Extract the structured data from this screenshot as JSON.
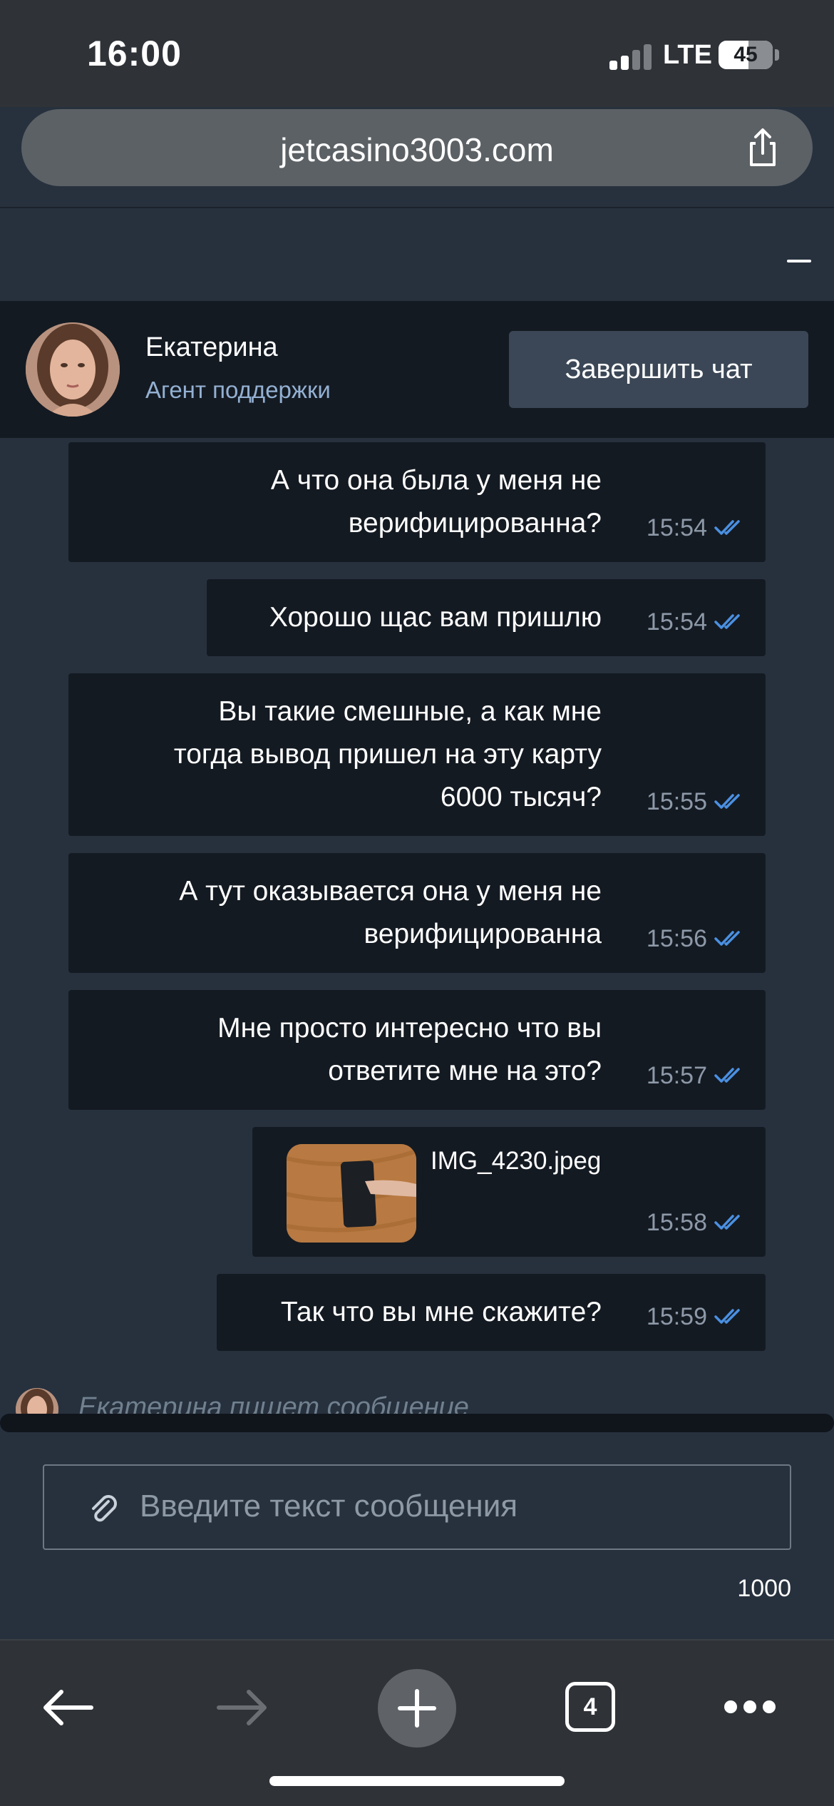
{
  "status_bar": {
    "time": "16:00",
    "network": "LTE",
    "battery": "45",
    "icons": [
      "signal-icon",
      "battery-icon"
    ]
  },
  "browser": {
    "url": "jetcasino3003.com",
    "icons": [
      "share-icon",
      "back-arrow-icon",
      "forward-arrow-icon",
      "new-tab-plus-icon",
      "tabs-icon",
      "more-icon"
    ],
    "tab_count": "4"
  },
  "chat": {
    "agent": {
      "name": "Екатерина",
      "role": "Агент поддержки"
    },
    "end_chat_label": "Завершить чат",
    "messages": [
      {
        "lines": [
          "А что она была у меня не",
          "верифицированна?"
        ],
        "time": "15:54"
      },
      {
        "lines": [
          "Хорошо щас вам пришлю"
        ],
        "time": "15:54"
      },
      {
        "lines": [
          "Вы такие смешные, а как мне",
          "тогда вывод пришел на эту карту",
          "6000 тысяч?"
        ],
        "time": "15:55"
      },
      {
        "lines": [
          "А тут оказывается она у меня не",
          "верифицированна"
        ],
        "time": "15:56"
      },
      {
        "lines": [
          "Мне просто интересно что вы",
          "ответите мне на это?"
        ],
        "time": "15:57"
      },
      {
        "attachment": "IMG_4230.jpeg",
        "time": "15:58"
      },
      {
        "lines": [
          "Так что вы мне скажите?"
        ],
        "time": "15:59"
      }
    ],
    "typing_indicator": "Екатерина пишет сообщение",
    "input_placeholder": "Введите текст сообщения",
    "char_counter": "1000",
    "colors": {
      "background": "#27313e",
      "bubble": "#141a22",
      "read_check": "#4a90e2"
    }
  }
}
